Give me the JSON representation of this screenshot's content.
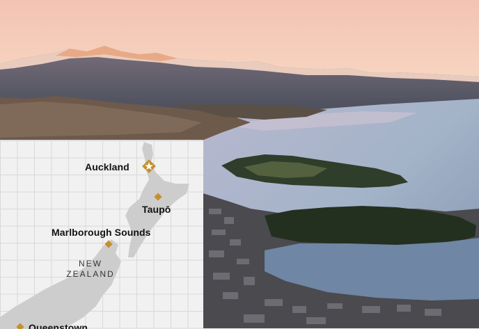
{
  "photo": {
    "subject": "",
    "colors": {
      "sky_top": "#f4c9b7",
      "sky_bottom": "#f8d9c4",
      "lake": "#9fb2c8",
      "mountain": "#5d5f6b",
      "hill": "#6f5b4c",
      "forest": "#2b3a28"
    }
  },
  "map": {
    "country_label_line1": "NEW",
    "country_label_line2": "ZEALAND",
    "marker_color": "#c4902f",
    "land_color": "#cfcfcf",
    "places": [
      {
        "name": "Auckland",
        "marker": "star-diamond-icon"
      },
      {
        "name": "Taupō",
        "marker": "diamond-icon"
      },
      {
        "name": "Marlborough Sounds",
        "marker": "diamond-icon"
      },
      {
        "name": "Queenstown",
        "marker": "diamond-icon"
      }
    ]
  }
}
